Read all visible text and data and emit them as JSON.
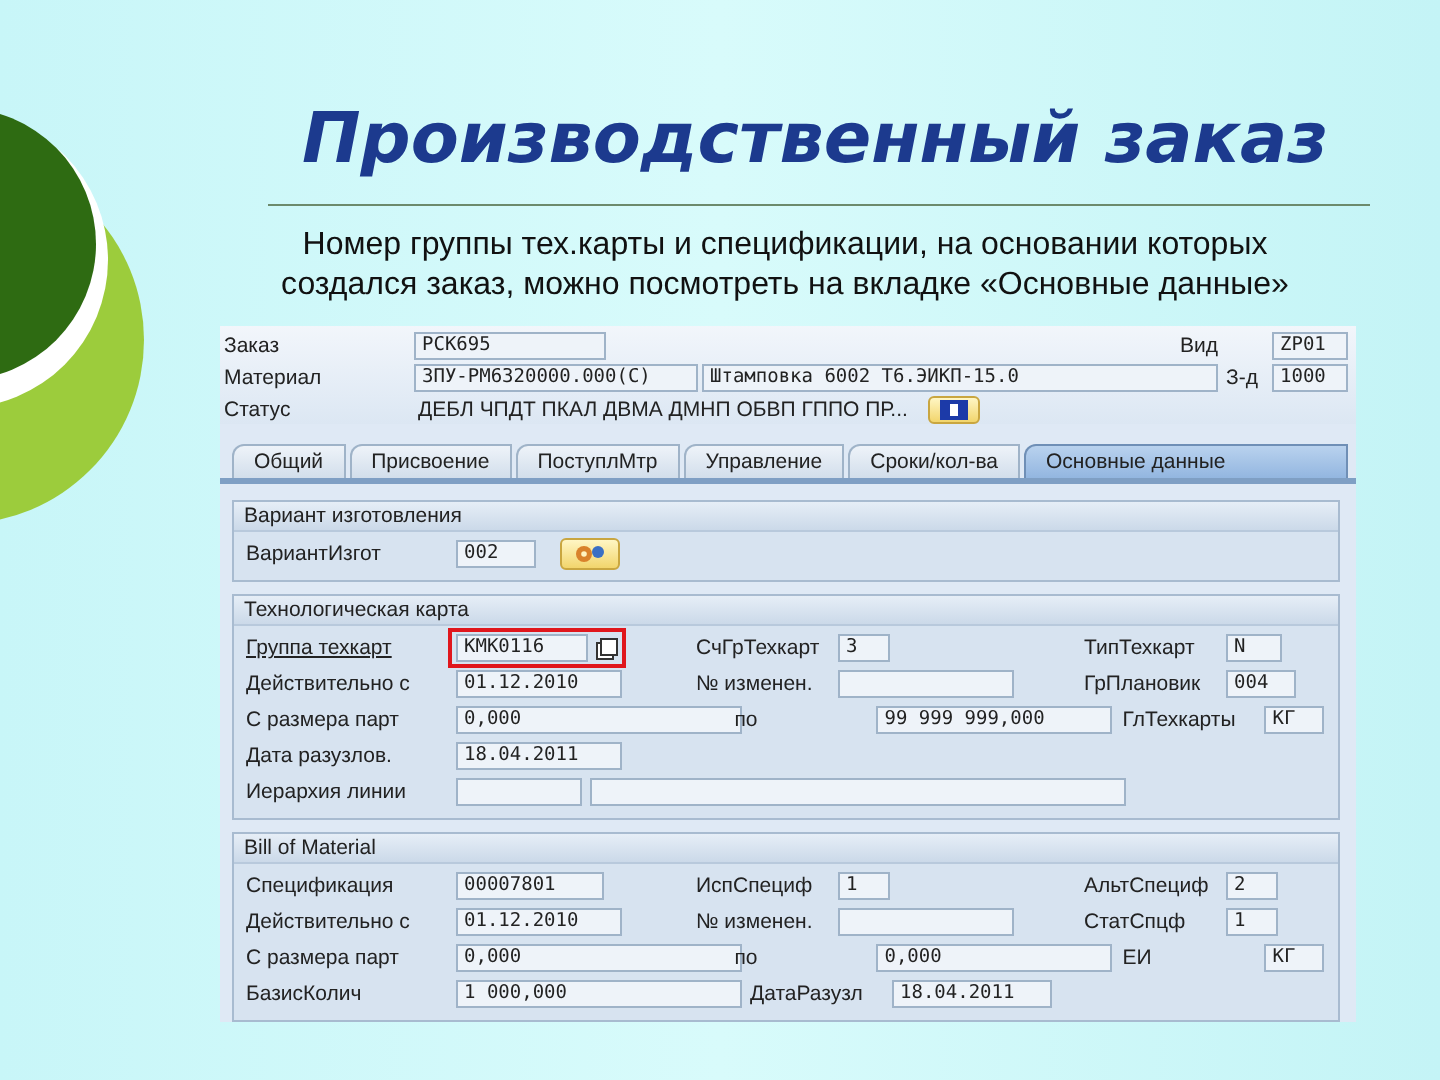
{
  "slide": {
    "title": "Производственный заказ",
    "text": "Номер группы тех.карты и спецификации, на основании которых создался заказ, можно посмотреть на вкладке «Основные данные»"
  },
  "sap": {
    "header": {
      "rows": [
        {
          "label": "Заказ",
          "fields": [
            "PCK695"
          ],
          "right": {
            "label": "Вид",
            "value": "ZP01"
          }
        },
        {
          "label": "Материал",
          "fields": [
            "ЗПУ-РМ6320000.000(С)",
            "Штамповка 6002 Т6.ЭИКП-15.0"
          ],
          "right": {
            "label": "З-д",
            "value": "1000"
          }
        },
        {
          "label": "Статус",
          "status": "ДЕБЛ ЧПДТ ПКАЛ ДВМА ДМНП ОБВП ГППО ПР..."
        }
      ]
    },
    "tabs": [
      {
        "label": "Общий",
        "selected": false
      },
      {
        "label": "Присвоение",
        "selected": false
      },
      {
        "label": "ПоступлМтр",
        "selected": false
      },
      {
        "label": "Управление",
        "selected": false
      },
      {
        "label": "Сроки/кол-ва",
        "selected": false
      },
      {
        "label": "Основные данные",
        "selected": true
      }
    ],
    "sections": [
      {
        "title": "Вариант изготовления",
        "rows": [
          [
            {
              "label": "ВариантИзгот",
              "link": false,
              "highlighted": false,
              "fields": [
                {
                  "kind": "input",
                  "value": "002"
                },
                {
                  "kind": "button"
                }
              ]
            }
          ]
        ]
      },
      {
        "title": "Технологическая карта",
        "rows": [
          [
            {
              "label": "Группа техкарт",
              "link": true,
              "highlighted": true,
              "fields": [
                {
                  "kind": "input",
                  "value": "КМК0116"
                },
                {
                  "kind": "value_help"
                }
              ]
            },
            {
              "label": "СчГрТехкарт",
              "link": false,
              "highlighted": false,
              "fields": [
                {
                  "kind": "input",
                  "value": "3"
                }
              ]
            },
            {
              "label": "ТипТехкарт",
              "link": false,
              "highlighted": false,
              "fields": [
                {
                  "kind": "input",
                  "value": "N"
                }
              ]
            }
          ],
          [
            {
              "label": "Действительно с",
              "link": false,
              "highlighted": false,
              "fields": [
                {
                  "kind": "input",
                  "value": "01.12.2010"
                }
              ]
            },
            {
              "label": "№ изменен.",
              "link": false,
              "highlighted": false,
              "fields": [
                {
                  "kind": "input"
                }
              ]
            },
            {
              "label": "ГрПлановик",
              "link": false,
              "highlighted": false,
              "fields": [
                {
                  "kind": "input",
                  "value": "004"
                }
              ]
            }
          ],
          [
            {
              "label": "С размера парт",
              "link": false,
              "highlighted": false,
              "fields": [
                {
                  "kind": "input",
                  "value": "0,000"
                }
              ]
            },
            {
              "label": "по",
              "link": false,
              "highlighted": false,
              "fields": [
                {
                  "kind": "input",
                  "value": "99 999 999,000"
                }
              ]
            },
            {
              "label": "ГлТехкарты",
              "link": false,
              "highlighted": false,
              "fields": [
                {
                  "kind": "input",
                  "value": "КГ"
                }
              ]
            }
          ],
          [
            {
              "label": "Дата разузлов.",
              "link": false,
              "highlighted": false,
              "fields": [
                {
                  "kind": "input",
                  "value": "18.04.2011"
                }
              ]
            }
          ],
          [
            {
              "label": "Иерархия линии",
              "link": false,
              "highlighted": false,
              "fields": [
                {
                  "kind": "input"
                },
                {
                  "kind": "input"
                }
              ]
            }
          ]
        ]
      },
      {
        "title": "Bill of Material",
        "rows": [
          [
            {
              "label": "Спецификация",
              "link": false,
              "highlighted": false,
              "fields": [
                {
                  "kind": "input",
                  "value": "00007801"
                }
              ]
            },
            {
              "label": "ИспСпециф",
              "link": false,
              "highlighted": false,
              "fields": [
                {
                  "kind": "input",
                  "value": "1"
                }
              ]
            },
            {
              "label": "АльтСпециф",
              "link": false,
              "highlighted": false,
              "fields": [
                {
                  "kind": "input",
                  "value": "2"
                }
              ]
            }
          ],
          [
            {
              "label": "Действительно с",
              "link": false,
              "highlighted": false,
              "fields": [
                {
                  "kind": "input",
                  "value": "01.12.2010"
                }
              ]
            },
            {
              "label": "№ изменен.",
              "link": false,
              "highlighted": false,
              "fields": [
                {
                  "kind": "input"
                }
              ]
            },
            {
              "label": "СтатСпцф",
              "link": false,
              "highlighted": false,
              "fields": [
                {
                  "kind": "input",
                  "value": "1"
                }
              ]
            }
          ],
          [
            {
              "label": "С размера парт",
              "link": false,
              "highlighted": false,
              "fields": [
                {
                  "kind": "input",
                  "value": "0,000"
                }
              ]
            },
            {
              "label": "по",
              "link": false,
              "highlighted": false,
              "fields": [
                {
                  "kind": "input",
                  "value": "0,000"
                }
              ]
            },
            {
              "label": "ЕИ",
              "link": false,
              "highlighted": false,
              "fields": [
                {
                  "kind": "input",
                  "value": "КГ"
                }
              ]
            }
          ],
          [
            {
              "label": "БазисКолич",
              "link": false,
              "highlighted": false,
              "fields": [
                {
                  "kind": "input",
                  "value": "1 000,000"
                }
              ]
            },
            {
              "label": "ДатаРазузл",
              "link": false,
              "highlighted": false,
              "fields": [
                {
                  "kind": "input",
                  "value": "18.04.2011"
                }
              ]
            }
          ]
        ]
      }
    ]
  }
}
